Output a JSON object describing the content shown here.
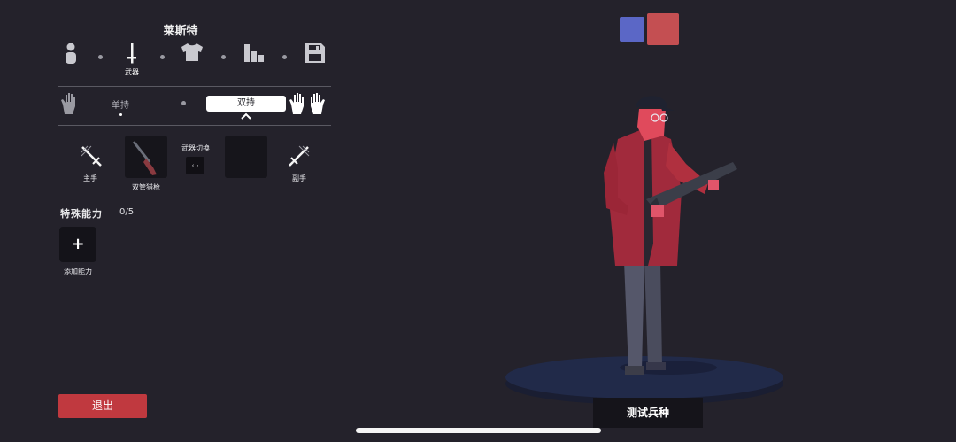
{
  "unit": {
    "name": "莱斯特"
  },
  "tabs": [
    {
      "icon": "person-icon",
      "label": ""
    },
    {
      "icon": "sword-icon",
      "label": "武器"
    },
    {
      "icon": "shirt-icon",
      "label": ""
    },
    {
      "icon": "stats-icon",
      "label": ""
    },
    {
      "icon": "save-icon",
      "label": ""
    }
  ],
  "grip": {
    "single_label": "单持",
    "dual_label": "双持",
    "selected": "dual"
  },
  "weapons": {
    "main_hand_label": "主手",
    "off_hand_label": "副手",
    "weapon_name": "双管猎枪",
    "switch_label": "武器切换",
    "switch_symbol": "‹ ›"
  },
  "abilities": {
    "title": "特殊能力",
    "count": "0/5",
    "add_symbol": "+",
    "add_label": "添加能力"
  },
  "exit_label": "退出",
  "test_label": "测试兵种",
  "team_colors": {
    "blue": "#5b67c6",
    "red": "#c44f52"
  }
}
